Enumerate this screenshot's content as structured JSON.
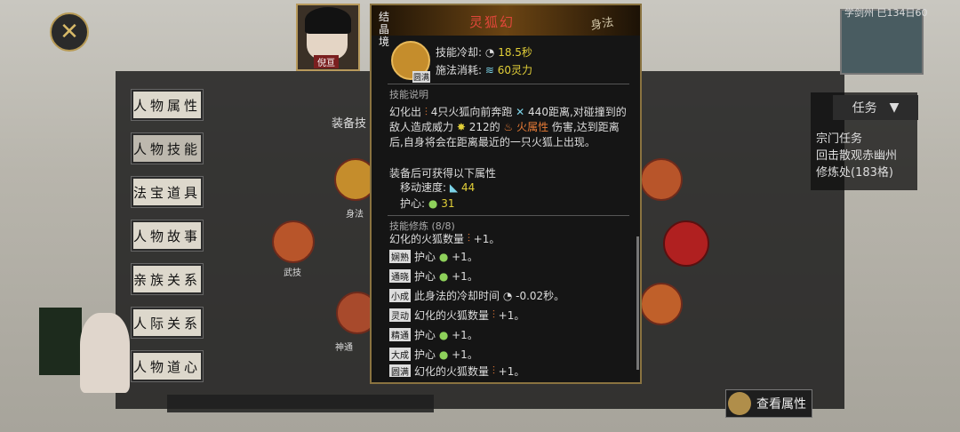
{
  "menu": {
    "items": [
      "人物属性",
      "人物技能",
      "法宝道具",
      "人物故事",
      "亲族关系",
      "人际关系",
      "人物道心"
    ],
    "active_index": 1
  },
  "portrait": {
    "name": "倪亘"
  },
  "equip": {
    "title": "装备技",
    "skills": [
      {
        "label": "身法",
        "icon": "fox-icon"
      },
      {
        "label": "武技",
        "icon": "staff-icon"
      },
      {
        "label": "神通",
        "icon": "meditation-icon"
      }
    ]
  },
  "tooltip": {
    "title": "灵狐幻",
    "realm": "结晶境",
    "category_tag": "身法",
    "skill_badge": "圆满",
    "cooldown_label": "技能冷却:",
    "cooldown_value": "18.5秒",
    "cost_label": "施法消耗:",
    "cost_value": "60灵力",
    "desc_title": "技能说明",
    "desc_parts": {
      "p1": "幻化出",
      "v1": "4只火狐向前奔跑",
      "v2": "440距离,对碰撞到的敌人造成威力",
      "v3": "212的",
      "v4": "火属性",
      "p2": "伤害,达到距离后,自身将会在距离最近的一只火狐上出现。"
    },
    "equip_bonus_title": "装备后可获得以下属性",
    "move_label": "移动速度:",
    "move_value": "44",
    "guard_label": "护心:",
    "guard_value": "31",
    "cultivation_title": "技能修炼 (8/8)",
    "cultivation": [
      {
        "tag": "",
        "text": "幻化的火狐数量",
        "value": "+1。"
      },
      {
        "tag": "娴熟",
        "text": "护心",
        "value": "+1。"
      },
      {
        "tag": "通晓",
        "text": "护心",
        "value": "+1。"
      },
      {
        "tag": "小成",
        "text": "此身法的冷却时间",
        "value": "-0.02秒。"
      },
      {
        "tag": "灵动",
        "text": "幻化的火狐数量",
        "value": "+1。"
      },
      {
        "tag": "精通",
        "text": "护心",
        "value": "+1。"
      },
      {
        "tag": "大成",
        "text": "护心",
        "value": "+1。"
      },
      {
        "tag": "圆满",
        "text": "幻化的火狐数量",
        "value": "+1。"
      }
    ]
  },
  "right": {
    "time": "学剑州 巳134日60",
    "task_button": "任务",
    "tasks": [
      "宗门任务",
      "回击散观赤幽州",
      "修炼处(183格)"
    ]
  },
  "view_attr_button": "查看属性",
  "colors": {
    "accent": "#8a7340",
    "title_red": "#e0473a",
    "value_yellow": "#e2cf38",
    "value_green": "#8ed15b"
  }
}
